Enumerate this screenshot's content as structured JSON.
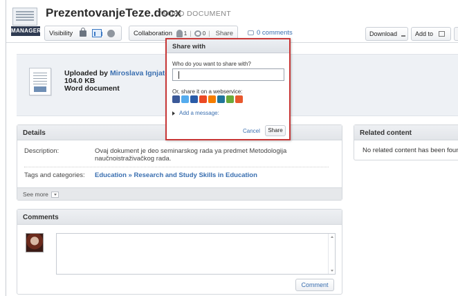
{
  "header": {
    "title": "PrezentovanjeTeze.docx",
    "doc_type": "WORD DOCUMENT",
    "badge": "MANAGER",
    "visibility_label": "Visibility",
    "collaboration_label": "Collaboration",
    "people_count": "1",
    "link_count": "0",
    "share_label": "Share",
    "comments_link": "0 comments",
    "download_label": "Download",
    "addto_label": "Add to"
  },
  "upload": {
    "uploaded_by_prefix": "Uploaded by ",
    "author": "Miroslava Ignjatovic",
    "size": "104.0 KB",
    "kind": "Word document"
  },
  "details": {
    "title": "Details",
    "description_label": "Description:",
    "description_value": "Ovaj dokument je deo seminarskog rada ya predmet Metodologija naučnoistraživačkog rada.",
    "tags_label": "Tags and categories:",
    "tags_value": "Education » Research and Study Skills in Education",
    "see_more": "See more"
  },
  "related": {
    "title": "Related content",
    "empty_text": "No related content has been found"
  },
  "comments": {
    "title": "Comments",
    "button": "Comment"
  },
  "share_popover": {
    "title": "Share with",
    "question": "Who do you want to share with?",
    "input_value": "",
    "or_text": "Or, share it on a webservice:",
    "services": [
      {
        "icon": "facebook-icon",
        "color": "#3b5998"
      },
      {
        "icon": "twitter-icon",
        "color": "#55acee"
      },
      {
        "icon": "delicious-icon",
        "color": "#2a5ca8"
      },
      {
        "icon": "stumbleupon-icon",
        "color": "#eb4924"
      },
      {
        "icon": "blogger-icon",
        "color": "#f57d00"
      },
      {
        "icon": "wordpress-icon",
        "color": "#21759b"
      },
      {
        "icon": "digg-icon",
        "color": "#6aaa3a"
      },
      {
        "icon": "more-services-icon",
        "color": "#e8582d"
      }
    ],
    "add_message": "Add a message:",
    "cancel_label": "Cancel",
    "share_button": "Share"
  }
}
